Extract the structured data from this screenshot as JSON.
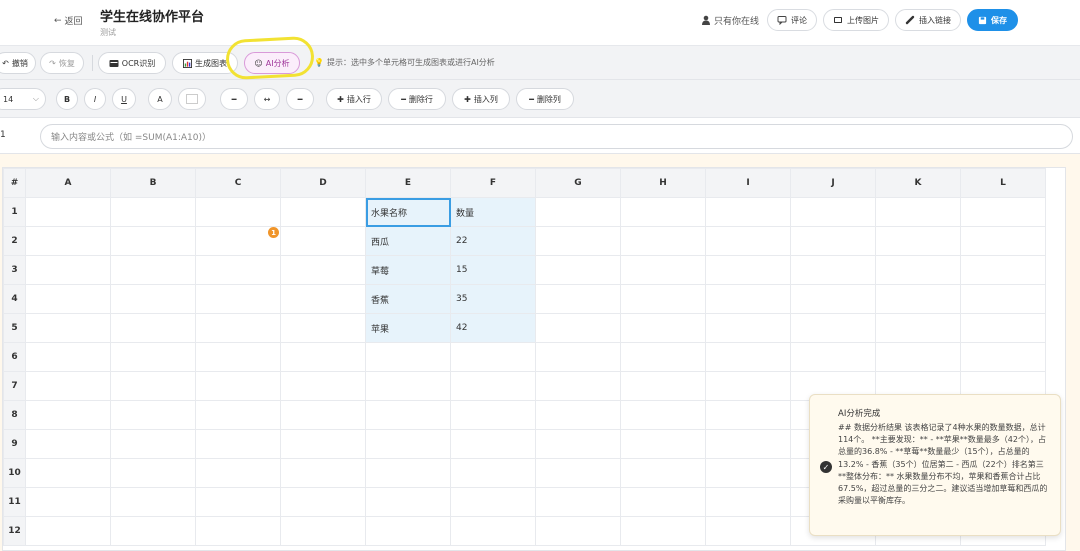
{
  "header": {
    "back_label": "返回",
    "app_title": "学生在线协作平台",
    "app_subtitle": "测试",
    "only_you": "只有你在线",
    "comment_label": "评论",
    "upload_image_label": "上传图片",
    "insert_link_label": "插入链接",
    "save_label": "保存"
  },
  "toolbar1": {
    "undo_label": "撤销",
    "redo_label": "恢复",
    "ocr_label": "OCR识别",
    "chart_label": "生成图表",
    "ai_label": "AI分析",
    "hint": "提示：选中多个单元格可生成图表或进行AI分析"
  },
  "toolbar2": {
    "font_size": "14",
    "bold": "B",
    "italic": "I",
    "underline": "U",
    "font_color": "A",
    "insert_row": "插入行",
    "delete_row": "删除行",
    "insert_col": "插入列",
    "delete_col": "删除列"
  },
  "formula_bar": {
    "cell_ref": "1",
    "placeholder": "输入内容或公式（如 =SUM(A1:A10)）"
  },
  "sheet": {
    "corner": "#",
    "columns": [
      "A",
      "B",
      "C",
      "D",
      "E",
      "F",
      "G",
      "H",
      "I",
      "J",
      "K",
      "L"
    ],
    "rows": [
      {
        "num": "1",
        "E": "水果名称",
        "F": "数量"
      },
      {
        "num": "2",
        "E": "西瓜",
        "F": "22"
      },
      {
        "num": "3",
        "E": "草莓",
        "F": "15"
      },
      {
        "num": "4",
        "E": "香蕉",
        "F": "35"
      },
      {
        "num": "5",
        "E": "苹果",
        "F": "42"
      },
      {
        "num": "6",
        "E": "",
        "F": ""
      },
      {
        "num": "7",
        "E": "",
        "F": ""
      },
      {
        "num": "8",
        "E": "",
        "F": ""
      },
      {
        "num": "9",
        "E": "",
        "F": ""
      },
      {
        "num": "10",
        "E": "",
        "F": ""
      },
      {
        "num": "11",
        "E": "",
        "F": ""
      },
      {
        "num": "12",
        "E": "",
        "F": ""
      }
    ],
    "comment_count": "1"
  },
  "notification": {
    "title": "AI分析完成",
    "body": "## 数据分析结果 该表格记录了4种水果的数量数据，总计114个。 **主要发现：** - **苹果**数量最多（42个），占总量的36.8% - **草莓**数量最少（15个），占总量的13.2% - 香蕉（35个）位居第二 - 西瓜（22个）排名第三 **整体分布：** 水果数量分布不均，苹果和香蕉合计占比67.5%，超过总量的三分之二。建议适当增加草莓和西瓜的采购量以平衡库存。"
  }
}
